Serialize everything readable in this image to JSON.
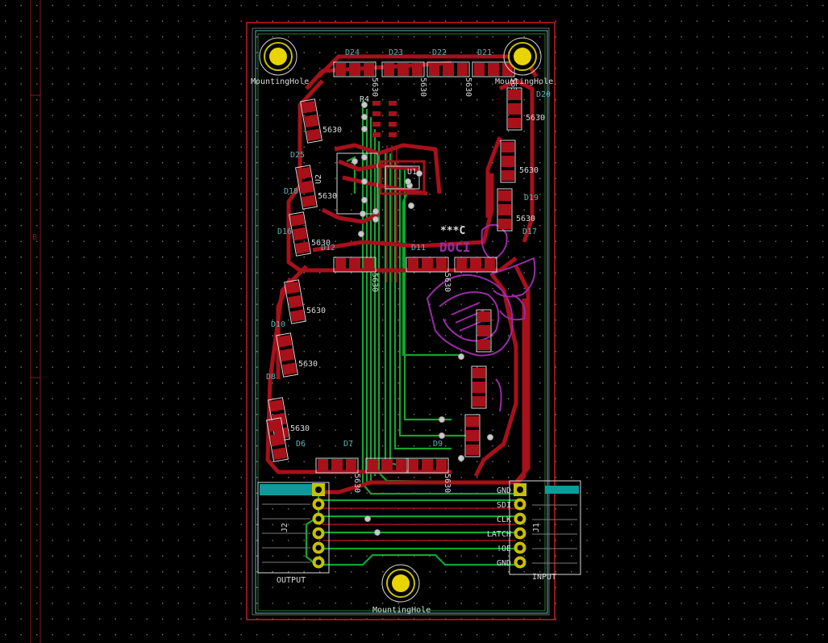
{
  "view": {
    "background": "#000000",
    "grid_color": "#7a7a7a",
    "sheet_border_color": "#8a1a1a",
    "sheet_marker": "B"
  },
  "colors": {
    "front_copper": "#a8101a",
    "back_copper": "#11a52e",
    "edge_cuts": "#c81c1c",
    "courtyard": "#6a6a6a",
    "fab_outline": "#5cb4b4",
    "silkscreen": "#d8d8d8",
    "logo": "#9b2aa5",
    "pad_gold": "#e8d400",
    "pad_cyan": "#0e9a9a"
  },
  "board": {
    "mounting_holes": [
      {
        "label": "MountingHole"
      },
      {
        "label": "MountingHole"
      },
      {
        "label": "MountingHole"
      }
    ],
    "leds": [
      {
        "ref": "D21",
        "pkg": "5630"
      },
      {
        "ref": "D22",
        "pkg": "5630"
      },
      {
        "ref": "D23",
        "pkg": "5630"
      },
      {
        "ref": "D24",
        "pkg": "5630"
      },
      {
        "ref": "D25",
        "pkg": "5630"
      },
      {
        "ref": "D20",
        "pkg": "5630"
      },
      {
        "ref": "D19",
        "pkg": "5630"
      },
      {
        "ref": "D18",
        "pkg": "5630"
      },
      {
        "ref": "D16",
        "pkg": "5630"
      },
      {
        "ref": "D17",
        "pkg": "5630"
      },
      {
        "ref": "D12",
        "pkg": "5630"
      },
      {
        "ref": "D11",
        "pkg": "5630"
      },
      {
        "ref": "D10",
        "pkg": "5630"
      },
      {
        "ref": "D9",
        "pkg": "5630"
      },
      {
        "ref": "D8",
        "pkg": "5630"
      },
      {
        "ref": "D7",
        "pkg": "5630"
      },
      {
        "ref": "D6",
        "pkg": "5630"
      }
    ],
    "texts": {
      "r4": "R4",
      "u1": "U1",
      "u2": "U2",
      "c_mark": "***C",
      "logo_text": "DOCI"
    },
    "connectors": {
      "output": {
        "ref": "J2",
        "label": "OUTPUT"
      },
      "input": {
        "ref": "J1",
        "label": "INPUT",
        "pins": [
          "GND",
          "SDI",
          "CLK",
          "LATCH",
          "!OE",
          "GND"
        ]
      }
    }
  }
}
